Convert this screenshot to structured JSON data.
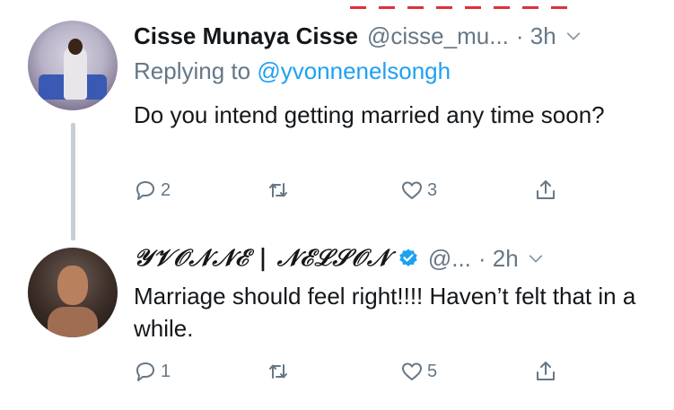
{
  "tweets": [
    {
      "author": "Cisse Munaya Cisse",
      "handle": "@cisse_mu...",
      "time": "· 3h",
      "replying_prefix": "Replying to ",
      "replying_to": "@yvonnenelsongh",
      "text": "Do you intend getting married any time soon?",
      "replies": "2",
      "retweets": "",
      "likes": "3"
    },
    {
      "author": "𝒴𝒱𝒪𝒩𝒩ℰ | 𝒩ℰℒ𝒮𝒪𝒩",
      "handle": "@...",
      "time": "· 2h",
      "verified": true,
      "text": "Marriage should feel right!!!! Haven’t felt that in a while.",
      "replies": "1",
      "retweets": "",
      "likes": "5"
    }
  ],
  "icons": {
    "reply": "reply-icon",
    "retweet": "retweet-icon",
    "like": "like-icon",
    "share": "share-icon",
    "caret": "chevron-down-icon",
    "verified": "verified-icon"
  },
  "colors": {
    "text": "#14171a",
    "secondary": "#657786",
    "link": "#1da1f2",
    "thread_line": "#c7ced4"
  }
}
